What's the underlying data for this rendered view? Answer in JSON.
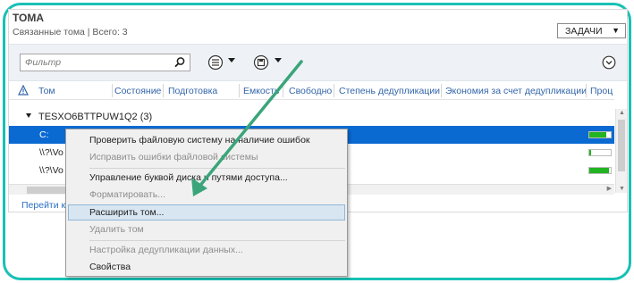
{
  "panel": {
    "title": "ТОМА",
    "subtitle": "Связанные тома | Всего: 3",
    "tasks_label": "ЗАДАЧИ"
  },
  "toolbar": {
    "filter_placeholder": "Фильтр",
    "icons": [
      "search-icon",
      "list-options-icon",
      "save-query-icon",
      "expand-icon"
    ]
  },
  "table": {
    "columns": [
      "Том",
      "Состояние",
      "Подготовка",
      "Емкость",
      "Свободно",
      "Степень дедупликации",
      "Экономия за счет дедупликации",
      "Проц"
    ],
    "group": "TESXO6BTTPUW1Q2 (3)",
    "rows": [
      {
        "name": "C:",
        "fill": 0.8,
        "selected": true
      },
      {
        "name": "\\\\?\\Vo",
        "fill": 0.1,
        "selected": false
      },
      {
        "name": "\\\\?\\Vo",
        "fill": 0.9,
        "selected": false
      }
    ]
  },
  "footer": {
    "link": "Перейти к"
  },
  "context_menu": {
    "items": [
      {
        "label": "Проверить файловую систему на наличие ошибок",
        "enabled": true
      },
      {
        "label": "Исправить ошибки файловой системы",
        "enabled": false
      },
      {
        "label": "Управление буквой диска и путями доступа...",
        "enabled": true
      },
      {
        "label": "Форматировать...",
        "enabled": false
      },
      {
        "label": "Расширить том...",
        "enabled": true,
        "highlighted": true
      },
      {
        "label": "Удалить том",
        "enabled": false
      },
      {
        "label": "Настройка дедупликации данных...",
        "enabled": false
      },
      {
        "label": "Свойства",
        "enabled": true
      }
    ]
  },
  "colors": {
    "frame": "#18c0b4",
    "selection": "#0a6ad2",
    "progress": "#22b422",
    "arrow": "#3aa57a"
  }
}
